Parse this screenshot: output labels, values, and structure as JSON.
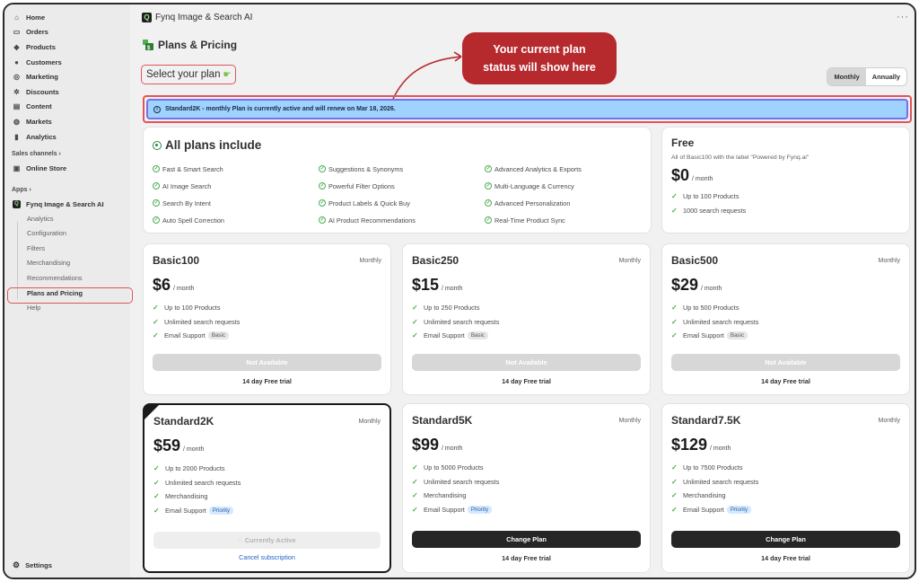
{
  "sidebar": {
    "nav": [
      {
        "label": "Home",
        "icon": "home-icon",
        "glyph": "⌂"
      },
      {
        "label": "Orders",
        "icon": "orders-icon",
        "glyph": "▭"
      },
      {
        "label": "Products",
        "icon": "tag-icon",
        "glyph": "◆"
      },
      {
        "label": "Customers",
        "icon": "person-icon",
        "glyph": "●"
      },
      {
        "label": "Marketing",
        "icon": "target-icon",
        "glyph": "◎"
      },
      {
        "label": "Discounts",
        "icon": "gear-badge-icon",
        "glyph": "✲"
      },
      {
        "label": "Content",
        "icon": "content-icon",
        "glyph": "▤"
      },
      {
        "label": "Markets",
        "icon": "globe-icon",
        "glyph": "◍"
      },
      {
        "label": "Analytics",
        "icon": "bar-chart-icon",
        "glyph": "▮"
      }
    ],
    "sales_channels_label": "Sales channels",
    "online_store_label": "Online Store",
    "apps_label": "Apps",
    "app_name": "Fynq Image & Search AI",
    "app_sub": [
      "Analytics",
      "Configuration",
      "Filters",
      "Merchandising",
      "Recommendations",
      "Plans and Pricing",
      "Help"
    ],
    "settings_label": "Settings"
  },
  "header": {
    "app_title": "Fynq Image & Search AI",
    "page_title": "Plans & Pricing",
    "select_plan": "Select your plan",
    "toggle": {
      "monthly": "Monthly",
      "annually": "Annually"
    }
  },
  "callout": {
    "line1": "Your current plan",
    "line2": "status will show here"
  },
  "banner": {
    "text": "Standard2K - monthly Plan is currently active and will renew on Mar 18, 2026."
  },
  "includes": {
    "title": "All plans include",
    "features": [
      "Fast & Smart Search",
      "Suggestions & Synonyms",
      "Advanced Analytics & Exports",
      "AI Image Search",
      "Powerful Filter Options",
      "Multi-Language & Currency",
      "Search By Intent",
      "Product Labels & Quick Buy",
      "Advanced Personalization",
      "Auto Spell Correction",
      "AI Product Recommendations",
      "Real-Time Product Sync"
    ]
  },
  "free": {
    "name": "Free",
    "sub": "All of Basic100 with the label \"Powered by Fynq.ai\"",
    "price": "$0",
    "per": "/ month",
    "benefits": [
      "Up to 100 Products",
      "1000 search requests"
    ]
  },
  "plans": [
    {
      "name": "Basic100",
      "cycle": "Monthly",
      "price": "$6",
      "per": "/ month",
      "products": "Up to 100 Products",
      "requests": "Unlimited search requests",
      "support": "Email Support",
      "tag": "Basic",
      "button": "Not Available",
      "trial": "14 day Free trial"
    },
    {
      "name": "Basic250",
      "cycle": "Monthly",
      "price": "$15",
      "per": "/ month",
      "products": "Up to 250 Products",
      "requests": "Unlimited search requests",
      "support": "Email Support",
      "tag": "Basic",
      "button": "Not Available",
      "trial": "14 day Free trial"
    },
    {
      "name": "Basic500",
      "cycle": "Monthly",
      "price": "$29",
      "per": "/ month",
      "products": "Up to 500 Products",
      "requests": "Unlimited search requests",
      "support": "Email Support",
      "tag": "Basic",
      "button": "Not Available",
      "trial": "14 day Free trial"
    },
    {
      "name": "Standard2K",
      "cycle": "Monthly",
      "price": "$59",
      "per": "/ month",
      "products": "Up to 2000 Products",
      "requests": "Unlimited search requests",
      "merch": "Merchandising",
      "support": "Email Support",
      "tag": "Priority",
      "button": "Currently Active",
      "cancel": "Cancel subscription"
    },
    {
      "name": "Standard5K",
      "cycle": "Monthly",
      "price": "$99",
      "per": "/ month",
      "products": "Up to 5000 Products",
      "requests": "Unlimited search requests",
      "merch": "Merchandising",
      "support": "Email Support",
      "tag": "Priority",
      "button": "Change Plan",
      "trial": "14 day Free trial"
    },
    {
      "name": "Standard7.5K",
      "cycle": "Monthly",
      "price": "$129",
      "per": "/ month",
      "products": "Up to 7500 Products",
      "requests": "Unlimited search requests",
      "merch": "Merchandising",
      "support": "Email Support",
      "tag": "Priority",
      "button": "Change Plan",
      "trial": "14 day Free trial"
    }
  ],
  "colors": {
    "accent_red": "#b62a2e",
    "banner_bg": "#9ed2ff",
    "check_green": "#4caf50"
  }
}
